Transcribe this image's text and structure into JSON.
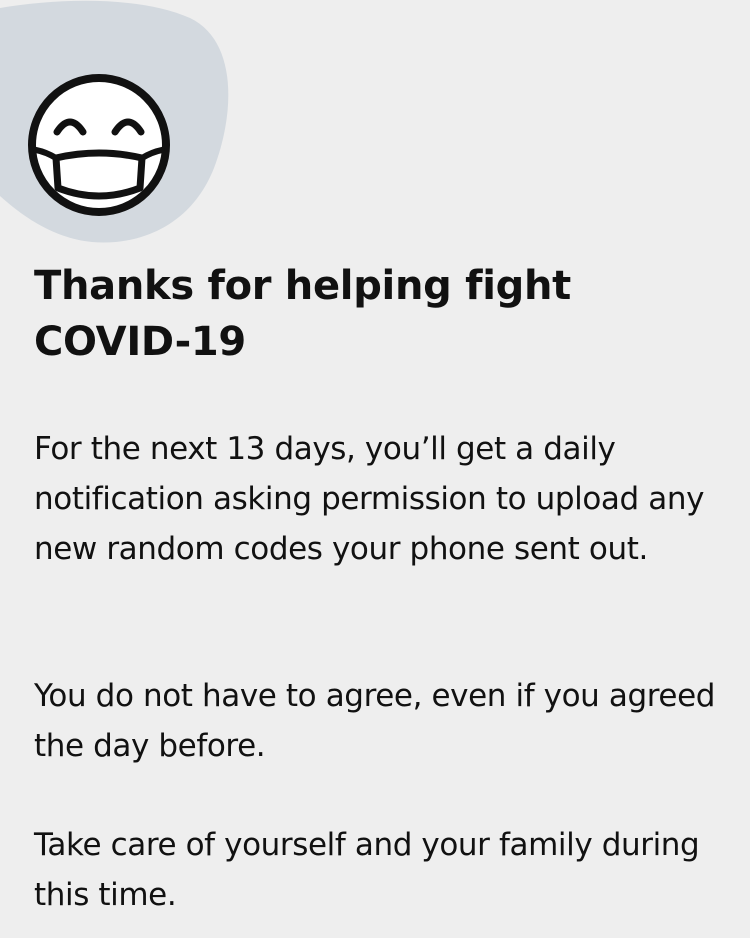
{
  "colors": {
    "background": "#eeeeee",
    "blob": "#d3d9df",
    "text": "#111111",
    "icon_stroke": "#111111",
    "icon_fill": "#ffffff"
  },
  "header_icon": "smiling-face-with-mask-icon",
  "title": "Thanks for helping fight COVID-19",
  "paragraphs": [
    "For the next 13 days, you’ll get a daily notification asking permission to upload any new random codes your phone sent out.",
    "You do not have to agree, even if you agreed the day before.",
    "Take care of yourself and your family during this time."
  ]
}
